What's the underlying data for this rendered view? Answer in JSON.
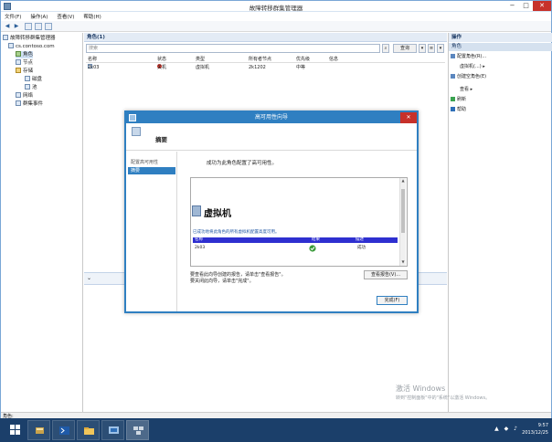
{
  "window": {
    "title": "故障转移群集管理器",
    "minimize": "−",
    "maximize": "□",
    "close": "✕"
  },
  "menu": [
    "文件(F)",
    "操作(A)",
    "查看(V)",
    "帮助(H)"
  ],
  "toolbar": {
    "back": "◀",
    "forward": "▶"
  },
  "tree": {
    "root": "故障转移群集管理器",
    "cluster": "cs.contoso.com",
    "items": [
      "角色",
      "节点",
      "存储",
      "磁盘",
      "池",
      "网络",
      "群集事件"
    ]
  },
  "roles": {
    "header": "角色(1)",
    "search_placeholder": "搜索",
    "query_label": "查询",
    "columns": [
      "名称",
      "状态",
      "类型",
      "所有者节点",
      "优先级",
      "信息"
    ],
    "rows": [
      {
        "name": "2k03",
        "status": "关机",
        "type": "虚拟机",
        "owner": "2k1202",
        "priority": "中等",
        "info": ""
      }
    ],
    "collapse_glyph": "⌄"
  },
  "actions": {
    "header": "操作",
    "section": "角色",
    "items": [
      "配置角色(R)...",
      "虚拟机(...)",
      "创建空角色(E)",
      "查看",
      "刷新",
      "帮助"
    ]
  },
  "watermark": {
    "line1": "激活 Windows",
    "line2": "转到\"控制面板\"中的\"系统\"以激活 Windows。"
  },
  "statusbar": {
    "text": "角色:"
  },
  "taskbar": {
    "time": "9:57",
    "date": "2013/12/25",
    "tray": "▲ ◆ ♪"
  },
  "dialog": {
    "title": "高可用性向导",
    "close": "✕",
    "step_title": "摘要",
    "nav": [
      "配置高可用性",
      "摘要"
    ],
    "message": "成功为此角色配置了高可用性。",
    "report": {
      "title": "虚拟机",
      "note": "已成功地将此角色的所有虚拟机配置高度可用。",
      "columns": [
        "名称",
        "结果",
        "描述"
      ],
      "rows": [
        {
          "name": "2k03",
          "result_icon": "success-check",
          "description": "成功"
        }
      ]
    },
    "footer_line1": "要查看此向导创建的报告，请单击\"查看报告\"。",
    "footer_line2": "要关闭此向导，请单击\"完成\"。",
    "view_report_label": "查看报告(V)...",
    "finish_label": "完成(F)"
  }
}
